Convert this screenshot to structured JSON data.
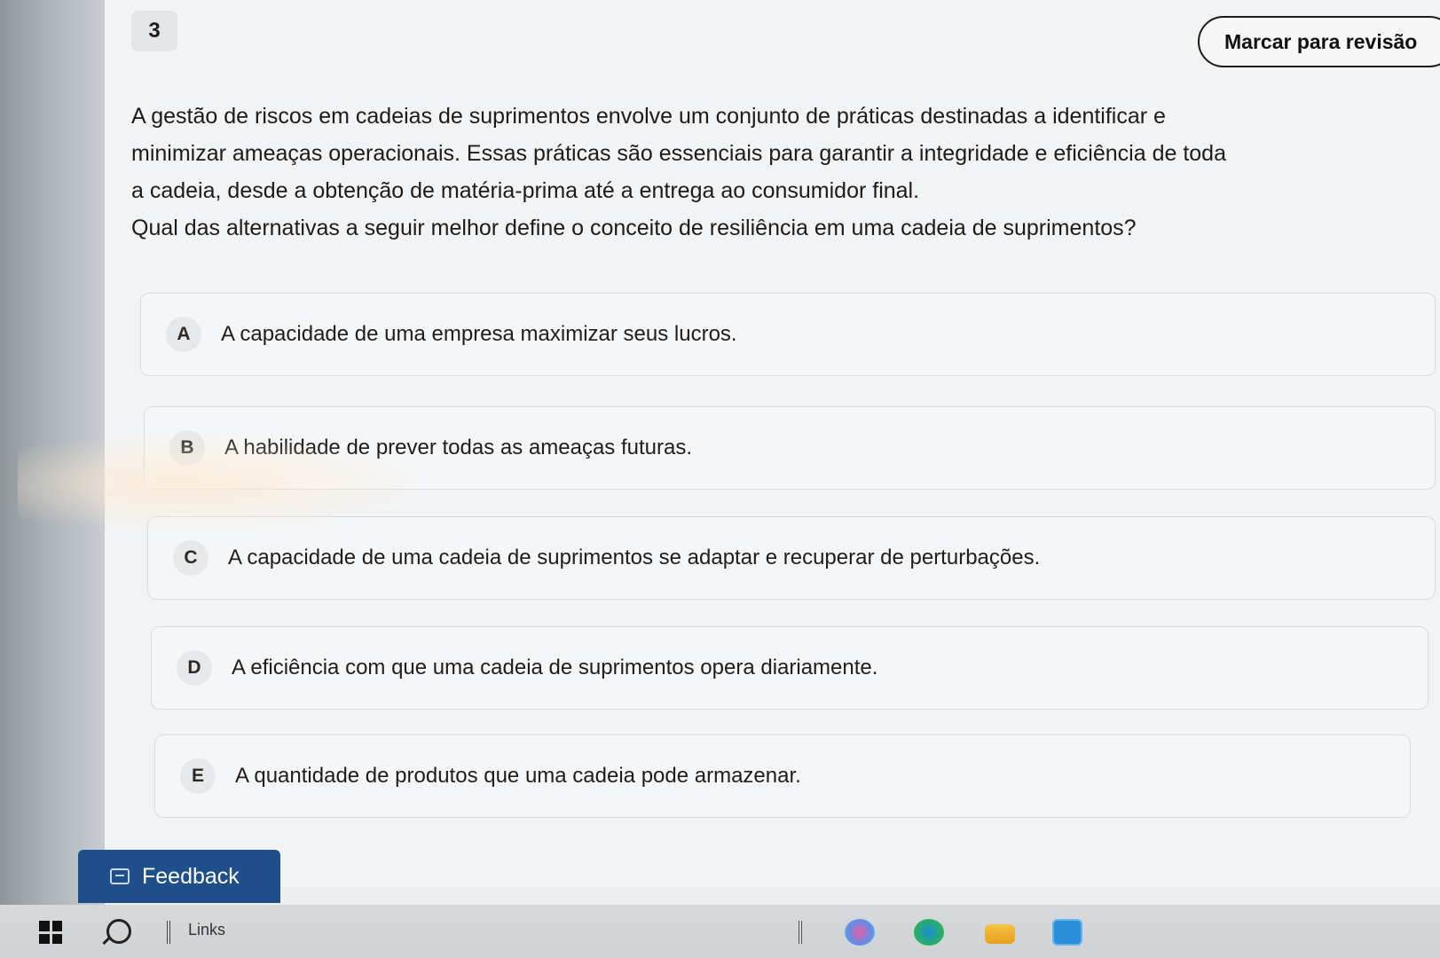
{
  "question": {
    "number": "3",
    "mark_review_label": "Marcar para revisão",
    "text_lines": [
      "A gestão de riscos em cadeias de suprimentos envolve um conjunto de práticas destinadas a identificar e",
      "minimizar ameaças operacionais. Essas práticas são essenciais para garantir a integridade e eficiência de toda",
      "a cadeia, desde a obtenção de matéria-prima até a entrega ao consumidor final."
    ],
    "prompt": "Qual das alternativas a seguir melhor define o conceito de resiliência em uma cadeia de suprimentos?"
  },
  "options": [
    {
      "letter": "A",
      "text": "A capacidade de uma empresa maximizar seus lucros."
    },
    {
      "letter": "B",
      "text": "A habilidade de prever todas as ameaças futuras."
    },
    {
      "letter": "C",
      "text": "A capacidade de uma cadeia de suprimentos se adaptar e recuperar de perturbações."
    },
    {
      "letter": "D",
      "text": "A eficiência com que uma cadeia de suprimentos opera diariamente."
    },
    {
      "letter": "E",
      "text": "A quantidade de produtos que uma cadeia pode armazenar."
    }
  ],
  "feedback": {
    "label": "Feedback",
    "icon": "feedback-icon"
  },
  "taskbar": {
    "links_label": "Links",
    "icons": [
      "windows-start-icon",
      "search-icon",
      "copilot-icon",
      "edge-icon",
      "file-explorer-icon",
      "store-icon"
    ]
  },
  "colors": {
    "feedback_bg": "#1f4f8a",
    "page_bg": "#f2f3f4"
  }
}
